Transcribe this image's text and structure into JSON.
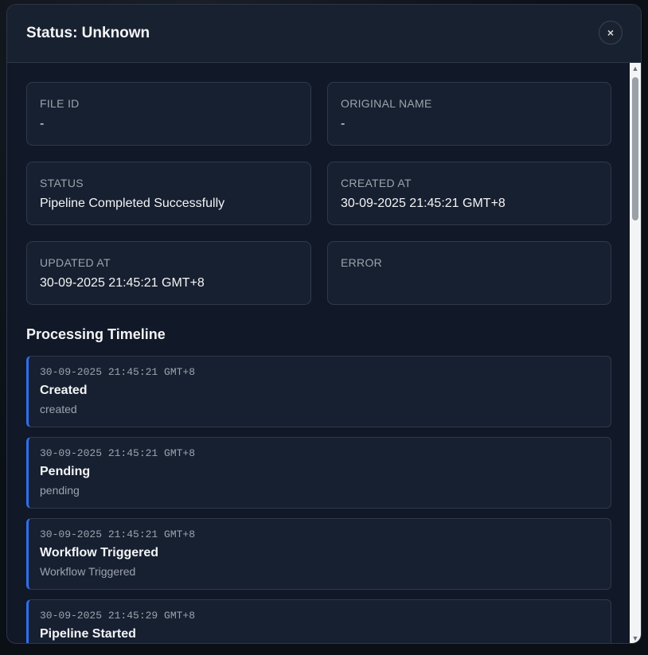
{
  "modal": {
    "title": "Status: Unknown",
    "close_label": "×"
  },
  "info": [
    {
      "label": "FILE ID",
      "value": "-"
    },
    {
      "label": "ORIGINAL NAME",
      "value": "-"
    },
    {
      "label": "STATUS",
      "value": "Pipeline Completed Successfully"
    },
    {
      "label": "CREATED AT",
      "value": "30-09-2025 21:45:21 GMT+8"
    },
    {
      "label": "UPDATED AT",
      "value": "30-09-2025 21:45:21 GMT+8"
    },
    {
      "label": "ERROR",
      "value": ""
    }
  ],
  "timeline": {
    "title": "Processing Timeline",
    "items": [
      {
        "time": "30-09-2025 21:45:21 GMT+8",
        "event": "Created",
        "detail": "created"
      },
      {
        "time": "30-09-2025 21:45:21 GMT+8",
        "event": "Pending",
        "detail": "pending"
      },
      {
        "time": "30-09-2025 21:45:21 GMT+8",
        "event": "Workflow Triggered",
        "detail": "Workflow Triggered"
      },
      {
        "time": "30-09-2025 21:45:29 GMT+8",
        "event": "Pipeline Started",
        "detail": ""
      }
    ]
  },
  "scrollbar": {
    "up_icon": "▲",
    "down_icon": "▼"
  },
  "colors": {
    "accent": "#2f6fed",
    "background": "#111827",
    "card": "#172030"
  }
}
